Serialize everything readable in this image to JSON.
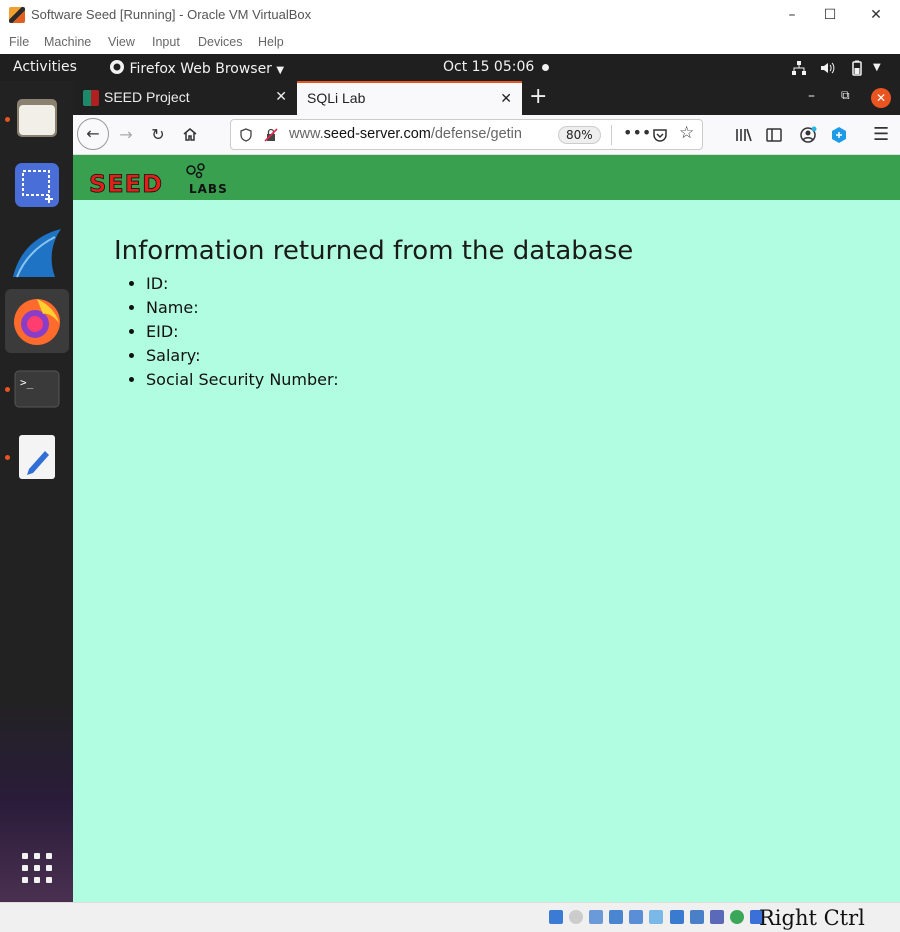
{
  "vbox": {
    "title": "Software Seed [Running] - Oracle VM VirtualBox",
    "menu": [
      "File",
      "Machine",
      "View",
      "Input",
      "Devices",
      "Help"
    ],
    "host_key": "Right Ctrl"
  },
  "gnome": {
    "activities": "Activities",
    "app_menu": "Firefox Web Browser",
    "clock": "Oct 15  05:06"
  },
  "dock": {
    "items": [
      "files",
      "screenshot",
      "wireshark",
      "firefox",
      "terminal",
      "text-editor",
      "show-apps"
    ]
  },
  "browser": {
    "tabs": [
      {
        "label": "SEED Project",
        "active": false
      },
      {
        "label": "SQLi Lab",
        "active": true
      }
    ],
    "url_prefix": "www.",
    "url_domain": "seed-server.com",
    "url_path": "/defense/getin",
    "zoom": "80%"
  },
  "page": {
    "logo_text": "SEED",
    "logo_sub": "LABS",
    "heading": "Information returned from the database",
    "fields": [
      "ID:",
      "Name:",
      "EID:",
      "Salary:",
      "Social Security Number:"
    ]
  }
}
